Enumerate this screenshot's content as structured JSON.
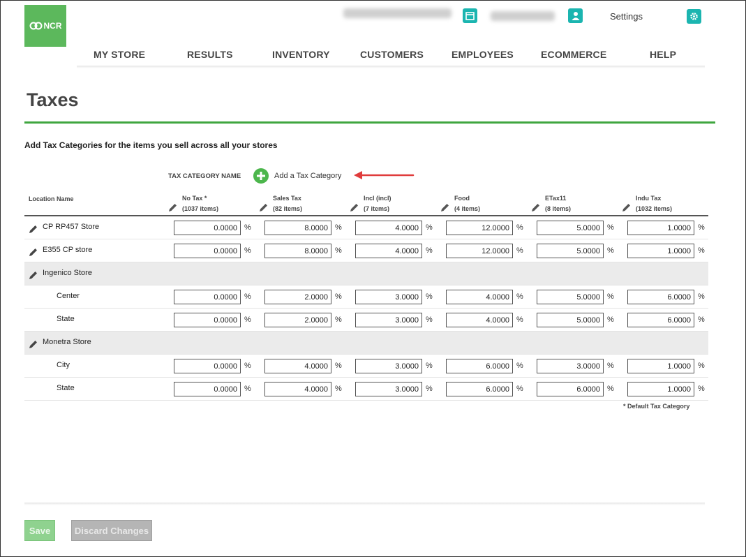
{
  "header": {
    "logo_text": "NCR",
    "settings_label": "Settings"
  },
  "nav": [
    {
      "label": "MY STORE"
    },
    {
      "label": "RESULTS"
    },
    {
      "label": "INVENTORY"
    },
    {
      "label": "CUSTOMERS"
    },
    {
      "label": "EMPLOYEES"
    },
    {
      "label": "ECOMMERCE"
    },
    {
      "label": "HELP"
    }
  ],
  "page": {
    "title": "Taxes",
    "intro": "Add Tax Categories for the items you sell across all your stores",
    "tax_category_name_label": "TAX CATEGORY NAME",
    "add_category_label": "Add a Tax Category",
    "footnote": "* Default Tax Category"
  },
  "table": {
    "location_header": "Location Name",
    "columns": [
      {
        "name": "No Tax *",
        "count": "(1037 items)"
      },
      {
        "name": "Sales Tax",
        "count": "(82 items)"
      },
      {
        "name": "Incl (incl)",
        "count": "(7 items)"
      },
      {
        "name": "Food",
        "count": "(4 items)"
      },
      {
        "name": "ETax11",
        "count": "(8 items)"
      },
      {
        "name": "Indu Tax",
        "count": "(1032 items)"
      }
    ],
    "rows": [
      {
        "name": "CP RP457 Store",
        "values": [
          "0.0000",
          "8.0000",
          "4.0000",
          "12.0000",
          "5.0000",
          "1.0000"
        ]
      },
      {
        "name": "E355 CP store",
        "values": [
          "0.0000",
          "8.0000",
          "4.0000",
          "12.0000",
          "5.0000",
          "1.0000"
        ]
      },
      {
        "name": "Ingenico Store"
      },
      {
        "name": "Center",
        "values": [
          "0.0000",
          "2.0000",
          "3.0000",
          "4.0000",
          "5.0000",
          "6.0000"
        ]
      },
      {
        "name": "State",
        "values": [
          "0.0000",
          "2.0000",
          "3.0000",
          "4.0000",
          "5.0000",
          "6.0000"
        ]
      },
      {
        "name": "Monetra Store"
      },
      {
        "name": "City",
        "values": [
          "0.0000",
          "4.0000",
          "3.0000",
          "6.0000",
          "3.0000",
          "1.0000"
        ]
      },
      {
        "name": "State",
        "values": [
          "0.0000",
          "4.0000",
          "3.0000",
          "6.0000",
          "6.0000",
          "1.0000"
        ]
      }
    ],
    "percent_symbol": "%"
  },
  "buttons": {
    "save": "Save",
    "discard": "Discard Changes"
  }
}
